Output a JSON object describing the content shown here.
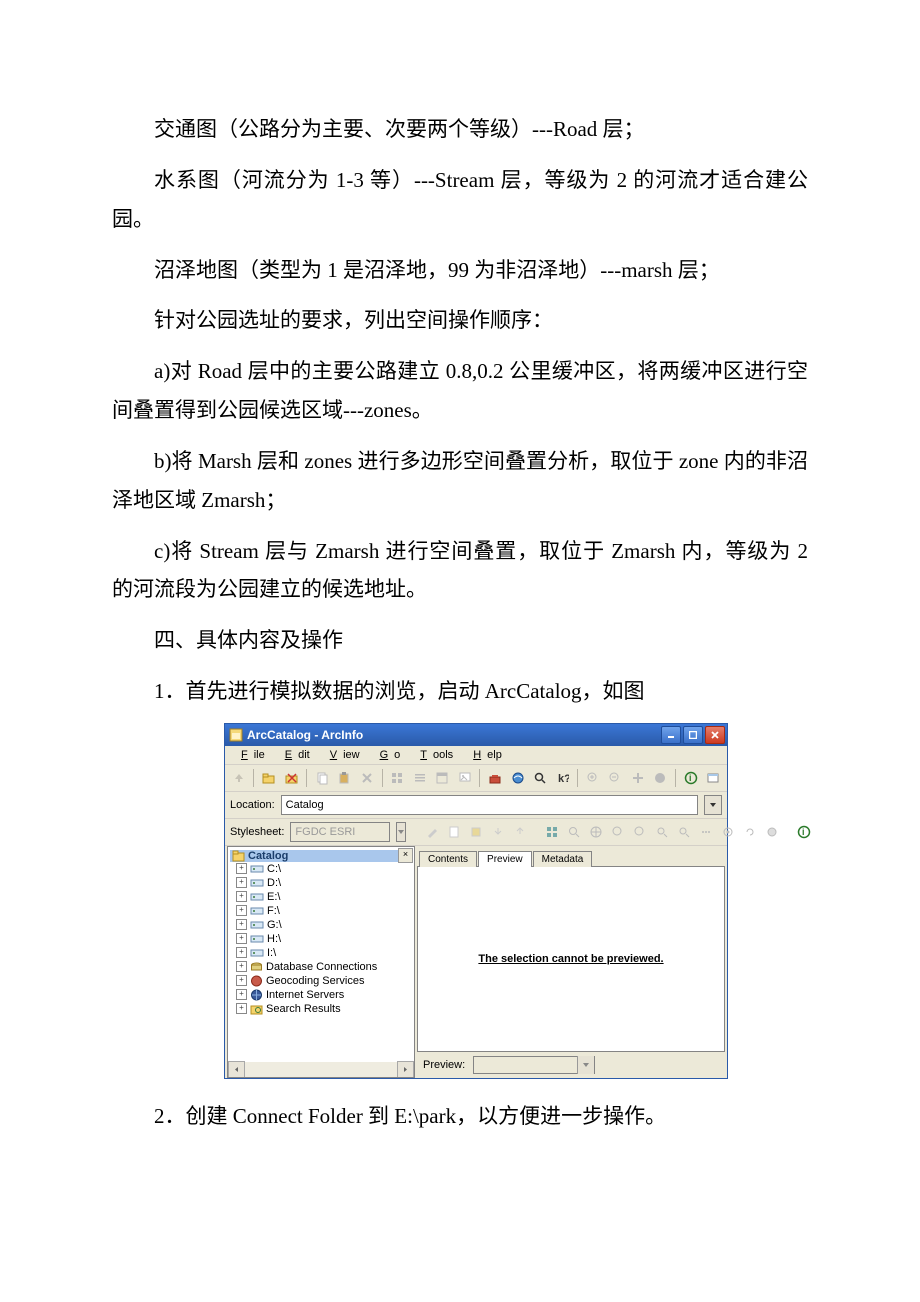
{
  "paragraphs": {
    "p1": "交通图（公路分为主要、次要两个等级）---Road 层；",
    "p2": "水系图（河流分为 1-3 等）---Stream 层，等级为 2 的河流才适合建公园。",
    "p3": "沼泽地图（类型为 1 是沼泽地，99 为非沼泽地）---marsh 层；",
    "p4": "针对公园选址的要求，列出空间操作顺序：",
    "p5": "a)对 Road 层中的主要公路建立 0.8,0.2 公里缓冲区，将两缓冲区进行空间叠置得到公园候选区域---zones。",
    "p6": "b)将 Marsh 层和 zones 进行多边形空间叠置分析，取位于 zone 内的非沼泽地区域 Zmarsh；",
    "p7": "c)将 Stream 层与 Zmarsh 进行空间叠置，取位于 Zmarsh 内，等级为 2 的河流段为公园建立的候选地址。",
    "p8": "四、具体内容及操作",
    "p9": "1．首先进行模拟数据的浏览，启动 ArcCatalog，如图",
    "p10": "2．创建 Connect Folder 到 E:\\park，以方便进一步操作。"
  },
  "arc": {
    "title": "ArcCatalog - ArcInfo",
    "menu": {
      "file": "File",
      "edit": "Edit",
      "view": "View",
      "go": "Go",
      "tools": "Tools",
      "help": "Help"
    },
    "location_label": "Location:",
    "location_value": "Catalog",
    "stylesheet_label": "Stylesheet:",
    "stylesheet_value": "FGDC ESRI",
    "tabs": {
      "contents": "Contents",
      "preview": "Preview",
      "metadata": "Metadata"
    },
    "message": "The selection cannot be previewed.",
    "preview_label": "Preview:",
    "tree": {
      "root": "Catalog",
      "drives": [
        "C:\\",
        "D:\\",
        "E:\\",
        "F:\\",
        "G:\\",
        "H:\\",
        "I:\\"
      ],
      "nodes": [
        "Database Connections",
        "Geocoding Services",
        "Internet Servers",
        "Search Results"
      ]
    }
  }
}
